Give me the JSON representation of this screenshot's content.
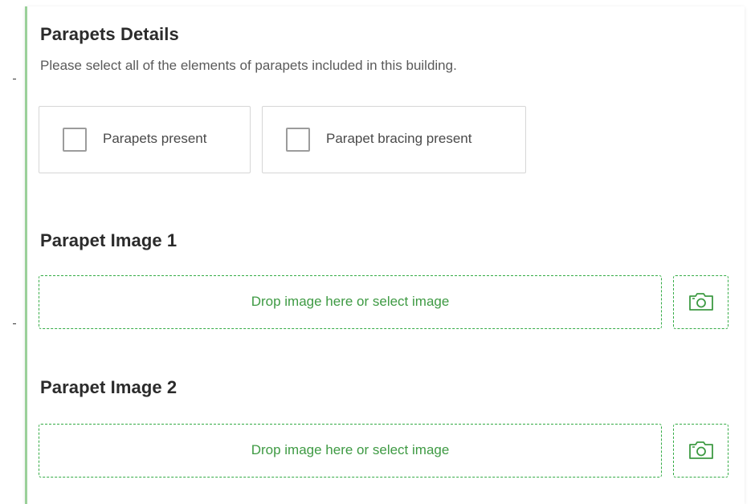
{
  "parapets_details": {
    "title": "Parapets Details",
    "description": "Please select all of the elements of parapets included in this building.",
    "options": [
      {
        "label": "Parapets present",
        "checked": false
      },
      {
        "label": "Parapet bracing present",
        "checked": false
      }
    ]
  },
  "image_fields": [
    {
      "title": "Parapet Image 1",
      "drop_text": "Drop image here or select image",
      "camera_icon": "camera-icon"
    },
    {
      "title": "Parapet Image 2",
      "drop_text": "Drop image here or select image",
      "camera_icon": "camera-icon"
    }
  ],
  "colors": {
    "accent_green": "#35ac46",
    "panel_left_border": "#9ad099",
    "checkbox_border": "#9c9c9c"
  }
}
